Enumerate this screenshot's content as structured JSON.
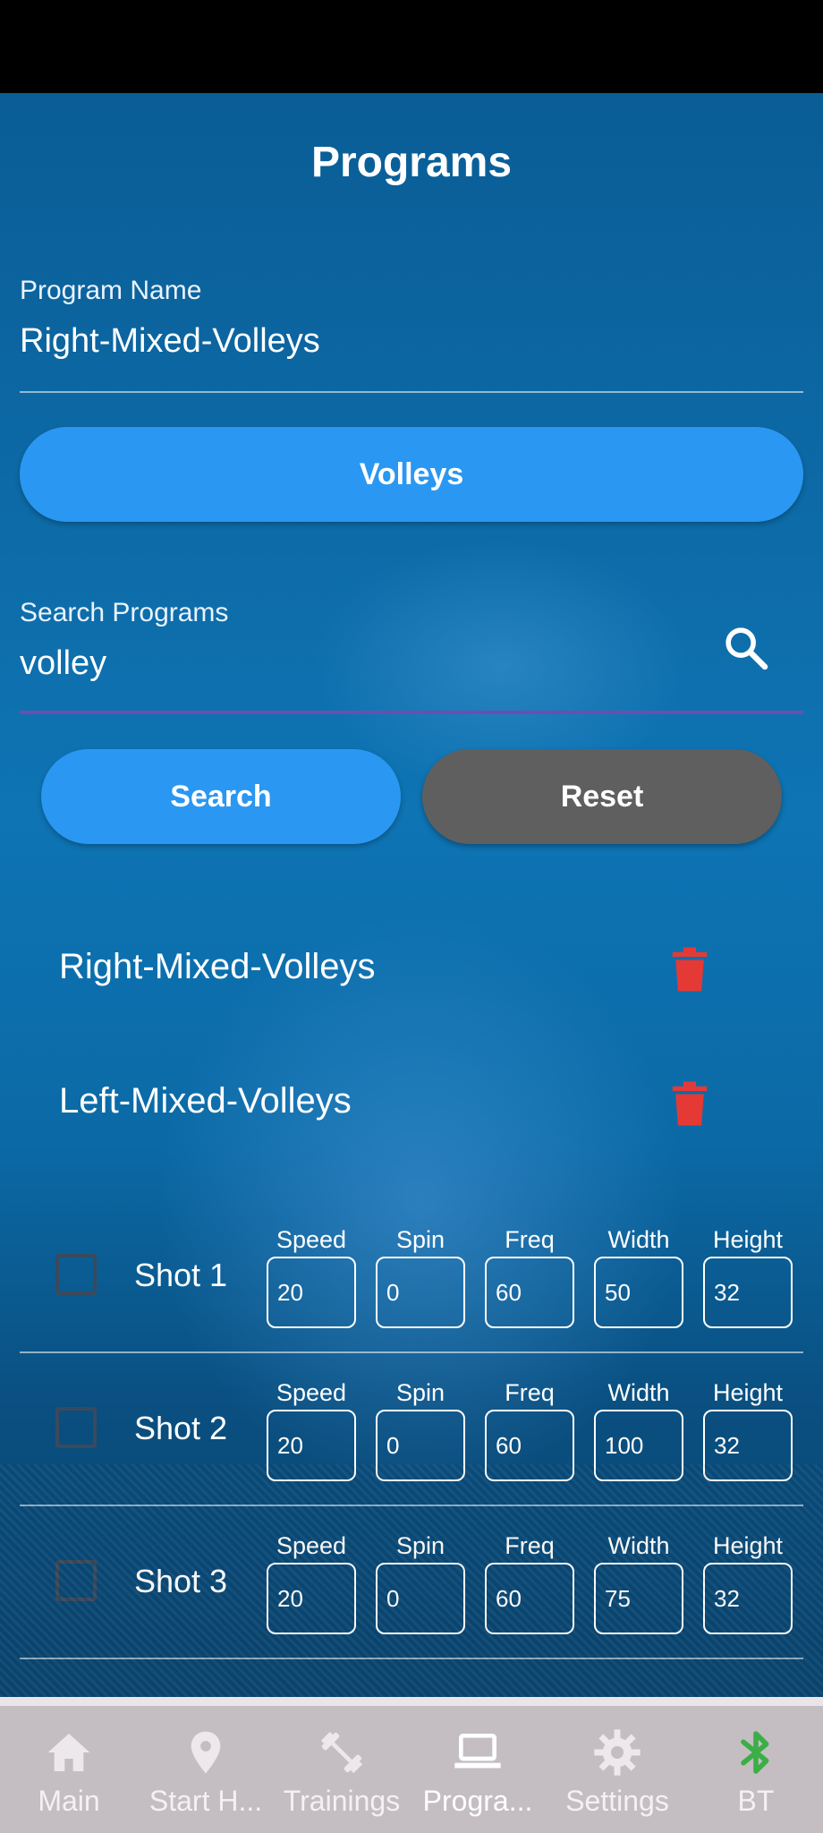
{
  "header": {
    "title": "Programs"
  },
  "program_name": {
    "label": "Program Name",
    "value": "Right-Mixed-Volleys"
  },
  "category_button": "Volleys",
  "search": {
    "label": "Search Programs",
    "value": "volley",
    "search_button": "Search",
    "reset_button": "Reset"
  },
  "programs": [
    {
      "name": "Right-Mixed-Volleys"
    },
    {
      "name": "Left-Mixed-Volleys"
    }
  ],
  "shot_columns": [
    "Speed",
    "Spin",
    "Freq",
    "Width",
    "Height"
  ],
  "shots": [
    {
      "label": "Shot 1",
      "values": [
        "20",
        "0",
        "60",
        "50",
        "32"
      ]
    },
    {
      "label": "Shot 2",
      "values": [
        "20",
        "0",
        "60",
        "100",
        "32"
      ]
    },
    {
      "label": "Shot 3",
      "values": [
        "20",
        "0",
        "60",
        "75",
        "32"
      ]
    }
  ],
  "nav": [
    {
      "label": "Main",
      "icon": "home-icon"
    },
    {
      "label": "Start H...",
      "icon": "location-pin-icon"
    },
    {
      "label": "Trainings",
      "icon": "dumbbell-icon"
    },
    {
      "label": "Progra...",
      "icon": "laptop-icon"
    },
    {
      "label": "Settings",
      "icon": "gear-icon"
    },
    {
      "label": "BT",
      "icon": "bluetooth-icon"
    }
  ],
  "colors": {
    "accent_blue": "#2a97f2",
    "reset_gray": "#5f5f5f",
    "delete_red": "#e53935",
    "bluetooth_green": "#3cae46",
    "search_underline": "#6a4fb0"
  }
}
